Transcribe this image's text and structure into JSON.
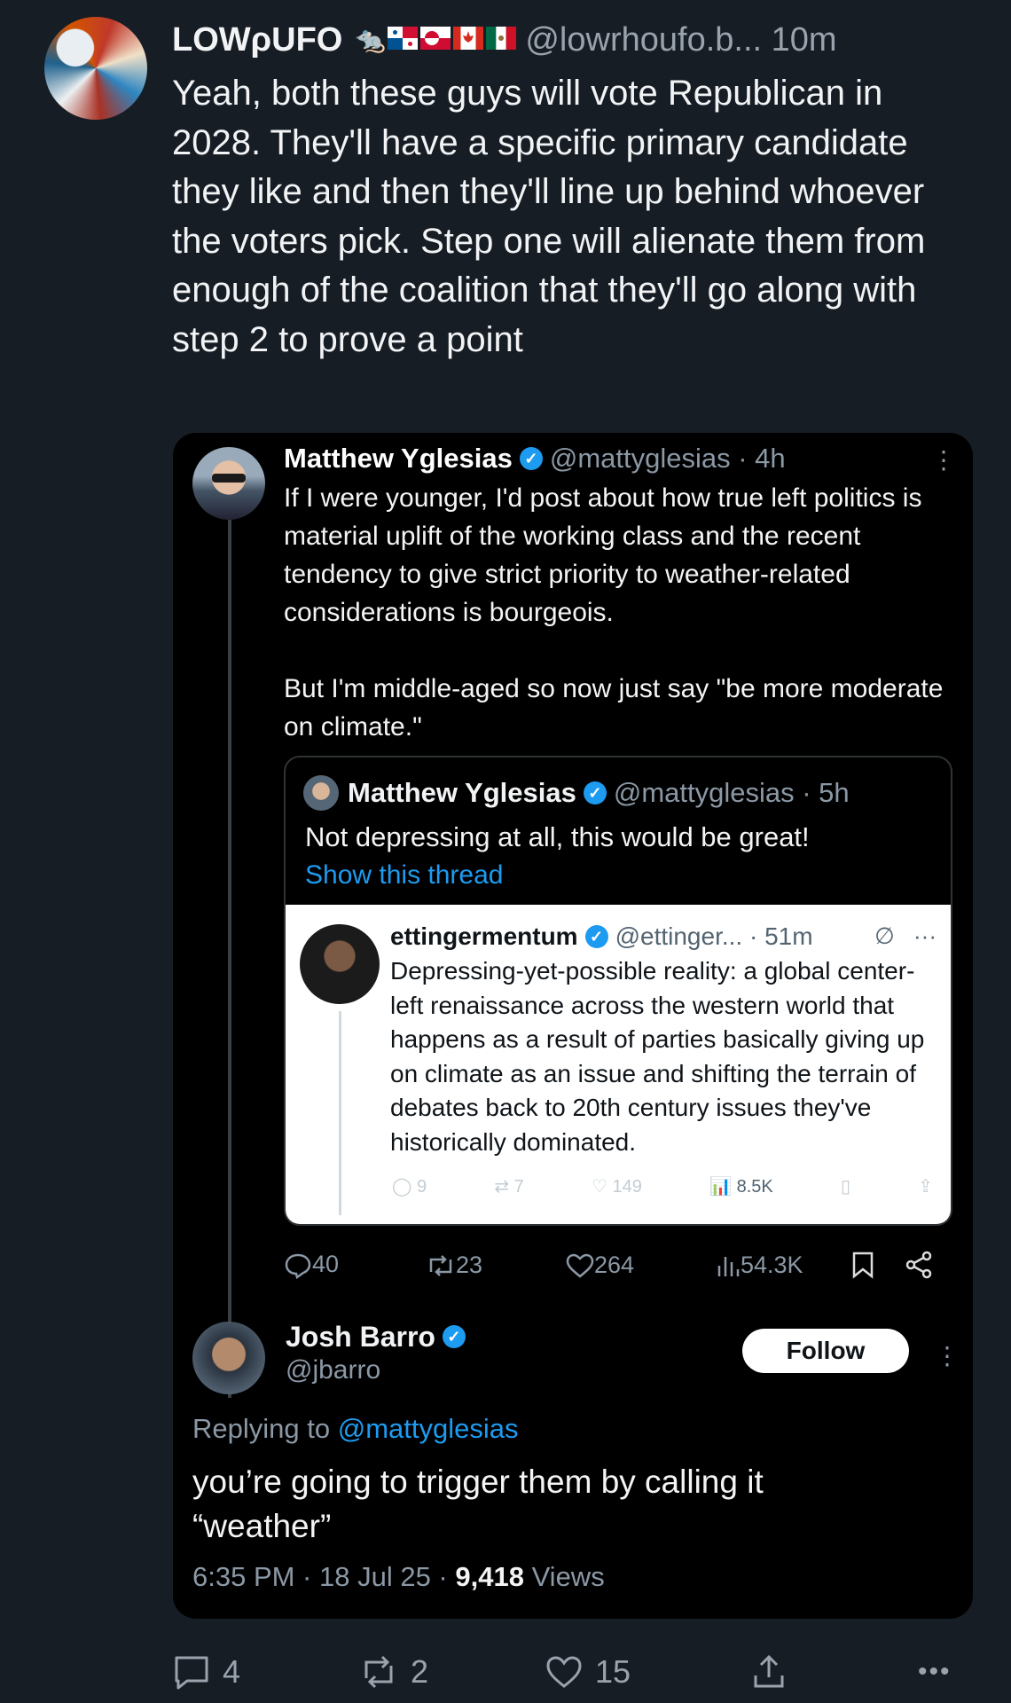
{
  "post": {
    "author_name": "LOWρUFO",
    "emoji_rat": "🐀",
    "handle_time": "@lowrhoufo.b... 10m",
    "text": "Yeah, both these guys will vote Republican in 2028. They'll have a specific primary candidate they like and then they'll line up behind whoever the voters pick. Step one will alienate them from enough of the coalition that they'll go along with step 2 to prove a point"
  },
  "embedded": {
    "author_name": "Matthew Yglesias",
    "verified_mark": "✓",
    "meta": "@mattyglesias · 4h",
    "body_p1": "If I were younger, I'd post about how true left politics is material uplift of the working class and the recent tendency to give strict priority to weather-related considerations is bourgeois.",
    "body_p2": "But I'm middle-aged so now just say \"be more moderate on climate.\"",
    "quote": {
      "author_name": "Matthew Yglesias",
      "meta": "@mattyglesias · 5h",
      "text": "Not depressing at all, this would be great!",
      "show_thread": "Show this thread",
      "screenshot": {
        "author_name": "ettingermentum",
        "meta": "@ettinger... · 51m",
        "body": "Depressing-yet-possible reality: a global center-left renaissance across the western world that happens as a result of parties basically giving up on climate as an issue and shifting the terrain of debates back to 20th century issues they've historically dominated.",
        "replies": "9",
        "reposts": "7",
        "likes": "149",
        "views": "8.5K"
      }
    },
    "stats": {
      "replies": "40",
      "reposts": "23",
      "likes": "264",
      "views": "54.3K"
    },
    "reply": {
      "author_name": "Josh Barro",
      "handle": "@jbarro",
      "follow_label": "Follow",
      "replying_prefix": "Replying to ",
      "replying_mention": "@mattyglesias",
      "text": "you’re going to trigger them by calling it “weather”",
      "time_date": "6:35 PM · 18 Jul 25 · ",
      "views_count": "9,418",
      "views_label": " Views"
    }
  },
  "actions": {
    "replies": "4",
    "reposts": "2",
    "likes": "15",
    "more": "•••"
  },
  "colors": {
    "background": "#171d24",
    "embed_background": "#000000",
    "link_blue": "#1d9bf0",
    "muted_text": "#8b98a5"
  }
}
